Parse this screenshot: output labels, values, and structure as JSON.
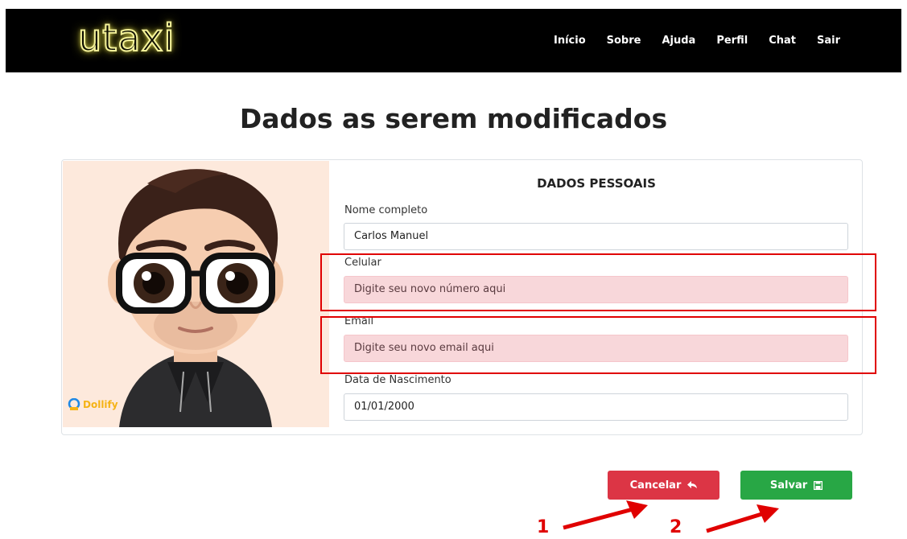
{
  "navbar": {
    "logo": "utaxi",
    "links": [
      "Início",
      "Sobre",
      "Ajuda",
      "Perfil",
      "Chat",
      "Sair"
    ]
  },
  "page": {
    "title": "Dados as serem modificados"
  },
  "avatar": {
    "badge": "Dollify"
  },
  "form": {
    "section_title": "DADOS PESSOAIS",
    "name_label": "Nome completo",
    "name_value": "Carlos Manuel",
    "phone_label": "Celular",
    "phone_placeholder": "Digite seu novo número aqui",
    "email_label": "Email",
    "email_placeholder": "Digite seu novo email aqui",
    "birth_label": "Data de Nascimento",
    "birth_value": "01/01/2000"
  },
  "buttons": {
    "cancel": "Cancelar",
    "save": "Salvar"
  },
  "annotations": [
    "1",
    "2"
  ],
  "colors": {
    "danger": "#dc3545",
    "success": "#28a745",
    "highlight": "#e00000",
    "logo_glow": "#f4f29a"
  },
  "icons": {
    "cancel": "reply-icon",
    "save": "floppy-disk-icon",
    "badge": "dollify-logo-icon"
  }
}
